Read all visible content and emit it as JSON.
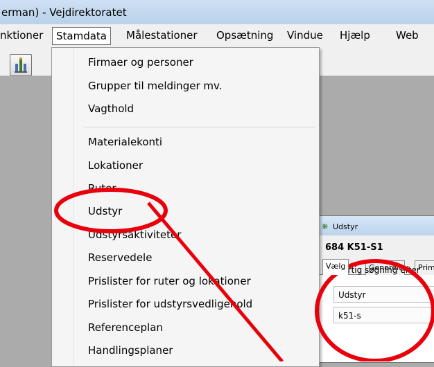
{
  "window": {
    "title": "erman) - Vejdirektoratet"
  },
  "menubar": {
    "items": [
      "nktioner",
      "Stamdata",
      "Målestationer",
      "Opsætning",
      "Vindue",
      "Hjælp",
      "Web"
    ],
    "active": "Stamdata"
  },
  "toolbar": {
    "button_icon": "station-icon"
  },
  "dropdown": {
    "group1": [
      "Firmaer og personer",
      "Grupper til meldinger mv.",
      "Vagthold"
    ],
    "group2": [
      "Materialekonti",
      "Lokationer",
      "Ruter",
      "Udstyr",
      "Udstyrsaktiviteter",
      "Reservedele",
      "Prislister for ruter og lokationer",
      "Prislister for udstyrsvedligehold",
      "Referenceplan",
      "Handlingsplaner"
    ]
  },
  "dialog": {
    "title": "Udstyr",
    "equipment_id": "684 K51-S1",
    "tabs": [
      "Vælg",
      "Generelt",
      "Prim"
    ],
    "quick_search_label": "Hurtig søgning efter",
    "search_type": "Udstyr",
    "search_value": "k51-s"
  },
  "annotation": {
    "color": "#e8000b"
  },
  "colors": {
    "desktop": "#ababab",
    "menu_bg": "#f5f5f5",
    "titlebar": "#c4d8ee"
  }
}
